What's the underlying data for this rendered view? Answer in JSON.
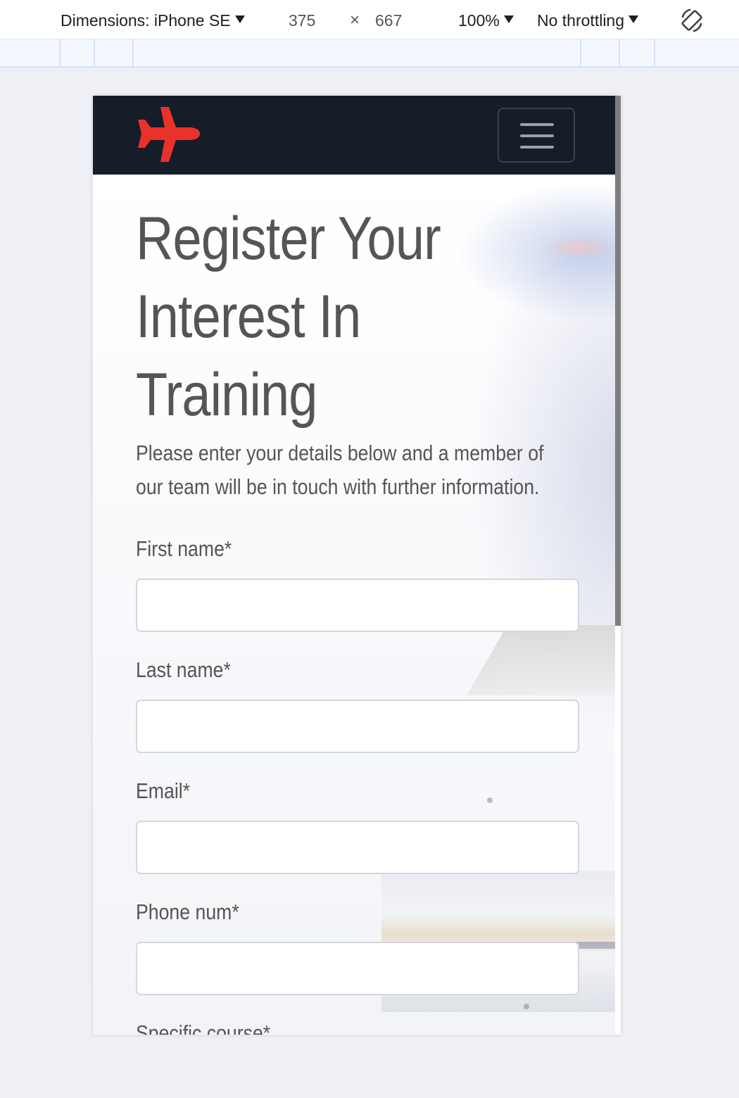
{
  "devtools": {
    "dimensions_label": "Dimensions: iPhone SE",
    "width": "375",
    "times": "×",
    "height": "667",
    "zoom": "100%",
    "throttling": "No throttling"
  },
  "page": {
    "title_lines": [
      "Register Your",
      "Interest In",
      "Training"
    ],
    "subtitle_lines": [
      "Please enter your details below and a member of",
      "our team will be in touch with further information."
    ],
    "brand_color": "#e8322a",
    "navbar_color": "#161d28"
  },
  "form": {
    "first_name": {
      "label": "First name*",
      "value": ""
    },
    "last_name": {
      "label": "Last name*",
      "value": ""
    },
    "email": {
      "label": "Email*",
      "value": ""
    },
    "phone": {
      "label": "Phone num*",
      "value": ""
    },
    "course": {
      "label": "Specific course*"
    }
  },
  "icons": {
    "brand": "airplane-icon",
    "menu": "hamburger-menu-icon",
    "rotate": "rotate-device-icon"
  }
}
